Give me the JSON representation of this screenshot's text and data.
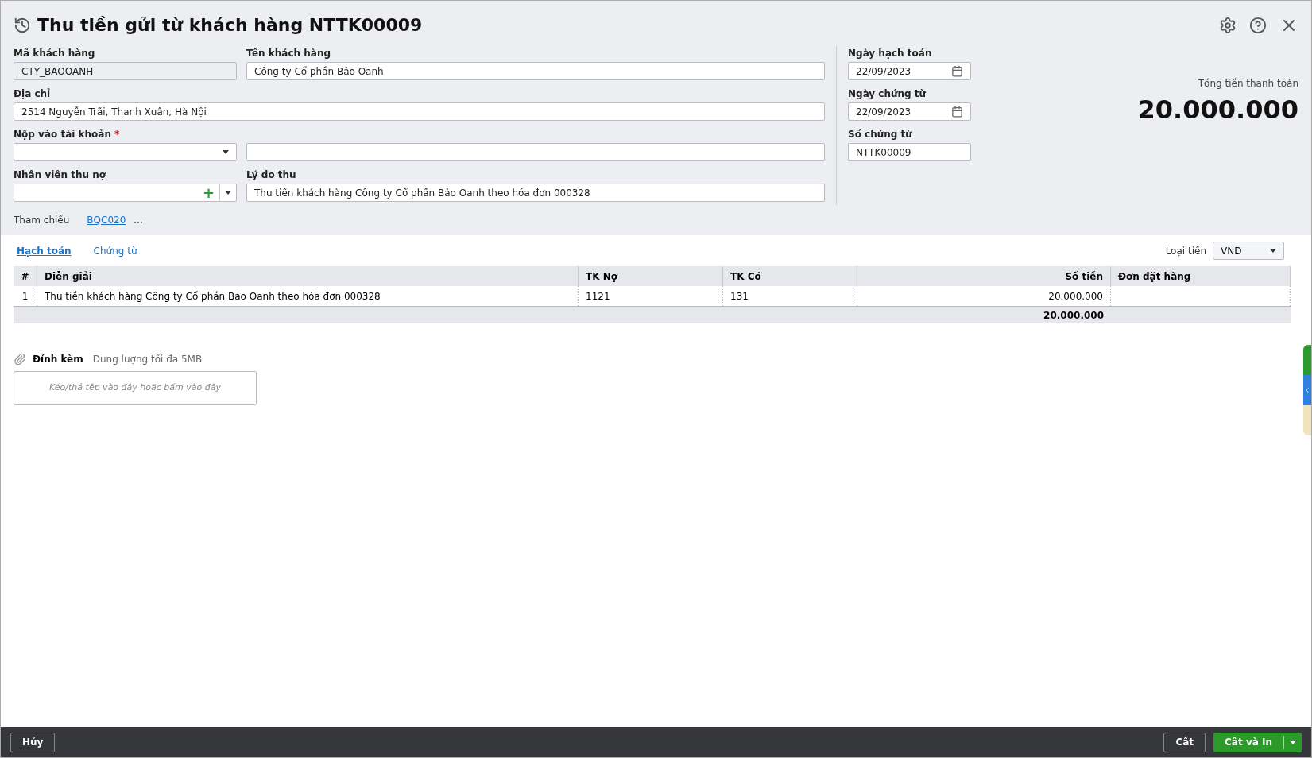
{
  "title": "Thu tiền gửi từ khách hàng NTTK00009",
  "customer_code": {
    "label": "Mã khách hàng",
    "value": "CTY_BAOOANH",
    "disabled": true
  },
  "customer_name": {
    "label": "Tên khách hàng",
    "value": "Công ty Cổ phần Bảo Oanh"
  },
  "address": {
    "label": "Địa chỉ",
    "value": "2514 Nguyễn Trãi, Thanh Xuân, Hà Nội"
  },
  "deposit_account": {
    "label": "Nộp vào tài khoản",
    "required_mark": "*"
  },
  "collector": {
    "label": "Nhân viên thu nợ",
    "add_symbol": "+"
  },
  "reason": {
    "label": "Lý do thu",
    "value": "Thu tiền khách hàng Công ty Cổ phần Bảo Oanh theo hóa đơn 000328"
  },
  "reference": {
    "label": "Tham chiếu",
    "link": "BQC020",
    "more": "..."
  },
  "posting_date": {
    "label": "Ngày hạch toán",
    "value": "22/09/2023"
  },
  "voucher_date": {
    "label": "Ngày chứng từ",
    "value": "22/09/2023"
  },
  "voucher_no": {
    "label": "Số chứng từ",
    "value": "NTTK00009"
  },
  "total": {
    "label": "Tổng tiền thanh toán",
    "value": "20.000.000"
  },
  "tabs": [
    {
      "label": "Hạch toán",
      "selected": true
    },
    {
      "label": "Chứng từ",
      "selected": false
    }
  ],
  "currency": {
    "label": "Loại tiền",
    "value": "VND"
  },
  "table": {
    "columns": [
      "#",
      "Diễn giải",
      "TK Nợ",
      "TK Có",
      "Số tiền",
      "Đơn đặt hàng"
    ],
    "rows": [
      [
        "1",
        "Thu tiền khách hàng Công ty Cổ phần Bảo Oanh theo hóa đơn 000328",
        "1121",
        "131",
        "20.000.000",
        ""
      ]
    ],
    "footer_total": "20.000.000"
  },
  "attachment": {
    "label": "Đính kèm",
    "hint": "Dung lượng tối đa 5MB",
    "dropzone": "Kéo/thả tệp vào đây hoặc bấm vào đây"
  },
  "buttons": {
    "cancel": "Hủy",
    "save": "Cất",
    "save_print": "Cất và In"
  }
}
